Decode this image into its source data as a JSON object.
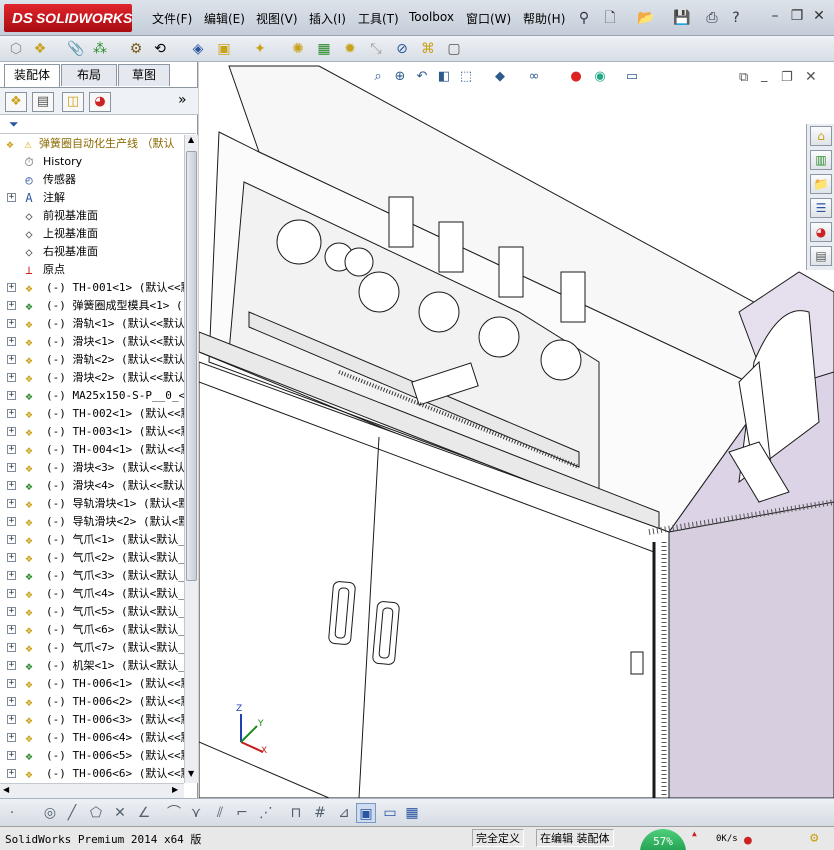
{
  "app": {
    "logo_text": "SOLIDWORKS",
    "logo_mark": "DS"
  },
  "menu": [
    {
      "label": "文件(F)"
    },
    {
      "label": "编辑(E)"
    },
    {
      "label": "视图(V)"
    },
    {
      "label": "插入(I)"
    },
    {
      "label": "工具(T)"
    },
    {
      "label": "Toolbox"
    },
    {
      "label": "窗口(W)"
    },
    {
      "label": "帮助(H)"
    }
  ],
  "panel_tabs": [
    {
      "label": "装配体"
    },
    {
      "label": "布局"
    },
    {
      "label": "草图"
    }
  ],
  "tree": {
    "root": "弹簧圈自动化生产线 （默认",
    "items": [
      {
        "label": "History",
        "icon": "history-icon"
      },
      {
        "label": "传感器",
        "icon": "sensor-icon"
      },
      {
        "label": "注解",
        "icon": "annotation-icon"
      },
      {
        "label": "前视基准面",
        "icon": "plane-icon"
      },
      {
        "label": "上视基准面",
        "icon": "plane-icon"
      },
      {
        "label": "右视基准面",
        "icon": "plane-icon"
      },
      {
        "label": "原点",
        "icon": "origin-icon"
      },
      {
        "label": "(-) TH-001<1> (默认<<默"
      },
      {
        "label": "(-) 弹簧圈成型模具<1> ("
      },
      {
        "label": "(-) 滑轨<1> (默认<<默认"
      },
      {
        "label": "(-) 滑块<1> (默认<<默认"
      },
      {
        "label": "(-) 滑轨<2> (默认<<默认"
      },
      {
        "label": "(-) 滑块<2> (默认<<默认"
      },
      {
        "label": "(-) MA25x150-S-P__0_<1>"
      },
      {
        "label": "(-) TH-002<1> (默认<<默"
      },
      {
        "label": "(-) TH-003<1> (默认<<默"
      },
      {
        "label": "(-) TH-004<1> (默认<<默"
      },
      {
        "label": "(-) 滑块<3> (默认<<默认"
      },
      {
        "label": "(-) 滑块<4> (默认<<默认"
      },
      {
        "label": "(-) 导轨滑块<1> (默认<默"
      },
      {
        "label": "(-) 导轨滑块<2> (默认<默"
      },
      {
        "label": "(-) 气爪<1> (默认<默认_"
      },
      {
        "label": "(-) 气爪<2> (默认<默认_"
      },
      {
        "label": "(-) 气爪<3> (默认<默认_"
      },
      {
        "label": "(-) 气爪<4> (默认<默认_"
      },
      {
        "label": "(-) 气爪<5> (默认<默认_"
      },
      {
        "label": "(-) 气爪<6> (默认<默认_"
      },
      {
        "label": "(-) 气爪<7> (默认<默认_"
      },
      {
        "label": "(-) 机架<1> (默认<默认_"
      },
      {
        "label": "(-) TH-006<1> (默认<<默"
      },
      {
        "label": "(-) TH-006<2> (默认<<默"
      },
      {
        "label": "(-) TH-006<3> (默认<<默"
      },
      {
        "label": "(-) TH-006<4> (默认<<默"
      },
      {
        "label": "(-) TH-006<5> (默认<<默"
      },
      {
        "label": "(-) TH-006<6> (默认<<默"
      }
    ]
  },
  "triad": {
    "x": "X",
    "y": "Y",
    "z": "Z"
  },
  "status": {
    "product": "SolidWorks Premium 2014 x64 版",
    "state": "完全定义",
    "mode": "在编辑 装配体",
    "cpu_percent": "57%",
    "net_speed": "0K/s"
  },
  "colors": {
    "accent": "#c0171d",
    "frame_side": "#d9d2e3",
    "viewport_bg": "#ffffff"
  }
}
